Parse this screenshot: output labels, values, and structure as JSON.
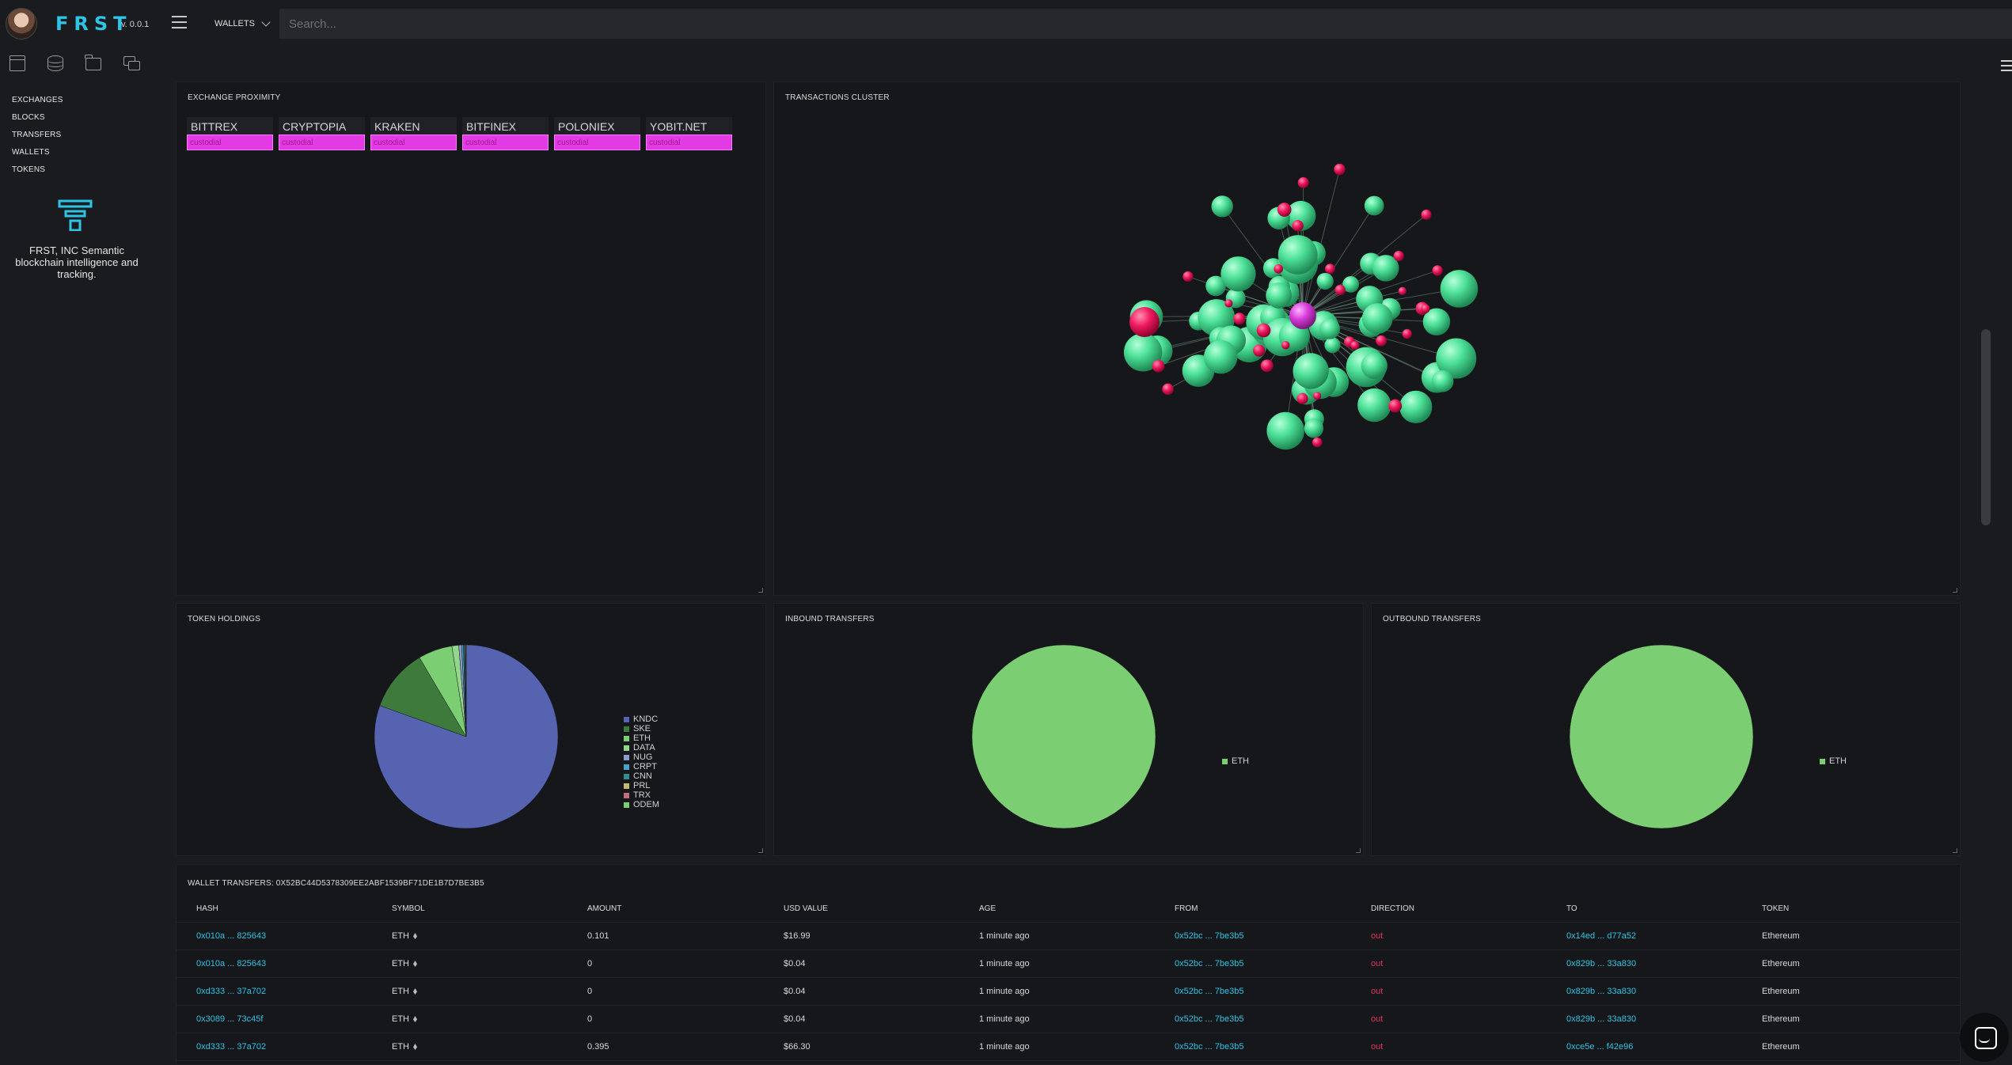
{
  "header": {
    "logo": "FRST",
    "version": "v. 0.0.1",
    "dropdown_label": "WALLETS",
    "search_placeholder": "Search..."
  },
  "sidebar": {
    "icons": [
      "window-icon",
      "database-icon",
      "folder-icon",
      "chat-icon"
    ],
    "items": [
      {
        "label": "EXCHANGES"
      },
      {
        "label": "BLOCKS"
      },
      {
        "label": "TRANSFERS"
      },
      {
        "label": "WALLETS"
      },
      {
        "label": "TOKENS"
      }
    ],
    "tagline": "FRST, INC Semantic blockchain intelligence and tracking."
  },
  "exchange_proximity": {
    "title": "EXCHANGE PROXIMITY",
    "exchanges": [
      {
        "name": "BITTREX",
        "tag": "custodial"
      },
      {
        "name": "CRYPTOPIA",
        "tag": "custodial"
      },
      {
        "name": "KRAKEN",
        "tag": "custodial"
      },
      {
        "name": "BITFINEX",
        "tag": "custodial"
      },
      {
        "name": "POLONIEX",
        "tag": "custodial"
      },
      {
        "name": "YOBIT.NET",
        "tag": "custodial"
      }
    ]
  },
  "transactions_cluster": {
    "title": "TRANSACTIONS CLUSTER"
  },
  "token_holdings": {
    "title": "TOKEN HOLDINGS",
    "legend": [
      {
        "name": "KNDC",
        "color": "#5563b0"
      },
      {
        "name": "SKE",
        "color": "#3e7a3c"
      },
      {
        "name": "ETH",
        "color": "#7bcf72"
      },
      {
        "name": "DATA",
        "color": "#7bcf72"
      },
      {
        "name": "NUG",
        "color": "#5563b0"
      },
      {
        "name": "CRPT",
        "color": "#4aa0c8"
      },
      {
        "name": "CNN",
        "color": "#2f8f8f"
      },
      {
        "name": "PRL",
        "color": "#c7b86a"
      },
      {
        "name": "TRX",
        "color": "#c36d7d"
      },
      {
        "name": "ODEM",
        "color": "#7bcf72"
      }
    ]
  },
  "inbound_transfers": {
    "title": "INBOUND TRANSFERS",
    "legend": [
      {
        "name": "ETH",
        "color": "#7bcf72"
      }
    ]
  },
  "outbound_transfers": {
    "title": "OUTBOUND TRANSFERS",
    "legend": [
      {
        "name": "ETH",
        "color": "#7bcf72"
      }
    ]
  },
  "chart_data": [
    {
      "type": "pie",
      "title": "TOKEN HOLDINGS",
      "categories": [
        "KNDC",
        "SKE",
        "ETH",
        "DATA",
        "NUG",
        "CRPT",
        "CNN",
        "PRL",
        "TRX",
        "ODEM"
      ],
      "values": [
        80.5,
        11,
        6,
        1.2,
        0.5,
        0.3,
        0.2,
        0.1,
        0.1,
        0.1
      ],
      "colors": [
        "#5563b0",
        "#3e7a3c",
        "#7bcf72",
        "#93d68c",
        "#8c9ac8",
        "#4aa0c8",
        "#2f8f8f",
        "#c7b86a",
        "#c36d7d",
        "#7bcf72"
      ],
      "legend": "right"
    },
    {
      "type": "pie",
      "title": "INBOUND TRANSFERS",
      "categories": [
        "ETH"
      ],
      "values": [
        100
      ],
      "colors": [
        "#7bcf72"
      ],
      "legend": "right"
    },
    {
      "type": "pie",
      "title": "OUTBOUND TRANSFERS",
      "categories": [
        "ETH"
      ],
      "values": [
        100
      ],
      "colors": [
        "#7bcf72"
      ],
      "legend": "right"
    }
  ],
  "wallet_transfers": {
    "title": "WALLET TRANSFERS: 0X52BC44D5378309EE2ABF1539BF71DE1B7D7BE3B5",
    "columns": [
      "HASH",
      "SYMBOL",
      "AMOUNT",
      "USD VALUE",
      "AGE",
      "FROM",
      "DIRECTION",
      "TO",
      "TOKEN"
    ],
    "rows": [
      {
        "hash": "0x010a ... 825643",
        "symbol": "ETH",
        "amount": "0.101",
        "usd": "$16.99",
        "age": "1 minute ago",
        "from": "0x52bc ... 7be3b5",
        "direction": "out",
        "to": "0x14ed ... d77a52",
        "token": "Ethereum"
      },
      {
        "hash": "0x010a ... 825643",
        "symbol": "ETH",
        "amount": "0",
        "usd": "$0.04",
        "age": "1 minute ago",
        "from": "0x52bc ... 7be3b5",
        "direction": "out",
        "to": "0x829b ... 33a830",
        "token": "Ethereum"
      },
      {
        "hash": "0xd333 ... 37a702",
        "symbol": "ETH",
        "amount": "0",
        "usd": "$0.04",
        "age": "1 minute ago",
        "from": "0x52bc ... 7be3b5",
        "direction": "out",
        "to": "0x829b ... 33a830",
        "token": "Ethereum"
      },
      {
        "hash": "0x3089 ... 73c45f",
        "symbol": "ETH",
        "amount": "0",
        "usd": "$0.04",
        "age": "1 minute ago",
        "from": "0x52bc ... 7be3b5",
        "direction": "out",
        "to": "0x829b ... 33a830",
        "token": "Ethereum"
      },
      {
        "hash": "0xd333 ... 37a702",
        "symbol": "ETH",
        "amount": "0.395",
        "usd": "$66.30",
        "age": "1 minute ago",
        "from": "0x52bc ... 7be3b5",
        "direction": "out",
        "to": "0xce5e ... f42e96",
        "token": "Ethereum"
      }
    ]
  }
}
